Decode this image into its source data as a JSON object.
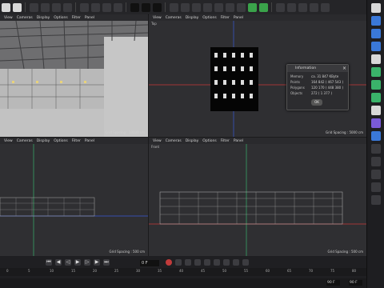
{
  "viewport_menu": [
    "View",
    "Cameras",
    "Display",
    "Options",
    "Filter",
    "Panel"
  ],
  "viewports": {
    "perspective": {
      "title": "",
      "grid": "Grid Spacing : 10000 cm"
    },
    "top": {
      "title": "Top",
      "grid": "Grid Spacing : 5000 cm"
    },
    "right": {
      "title": "Right",
      "grid": "Grid Spacing : 500 cm"
    },
    "front": {
      "title": "Front",
      "grid": "Grid Spacing : 500 cm"
    }
  },
  "info_dialog": {
    "title": "Information",
    "rows": [
      {
        "label": "Memory",
        "value": "ca. 31 847 KByte"
      },
      {
        "label": "Points",
        "value": "164 842 ( 467 543 )"
      },
      {
        "label": "Polygons",
        "value": "120 170 ( 448 380 )"
      },
      {
        "label": "Objects",
        "value": "272 ( 1 377 )"
      }
    ],
    "ok": "OK"
  },
  "timeline": {
    "current_frame": "0 F",
    "ruler_ticks": [
      "0",
      "5",
      "10",
      "15",
      "20",
      "25",
      "30",
      "35",
      "40",
      "45",
      "50",
      "55",
      "60",
      "65",
      "70",
      "75",
      "80",
      "85",
      "90"
    ],
    "start_field": "90 F",
    "end_field": "90 F"
  },
  "colors": {
    "x_axis": "#c83a3a",
    "y_axis": "#3ab36a",
    "z_axis": "#3a5ad8"
  }
}
